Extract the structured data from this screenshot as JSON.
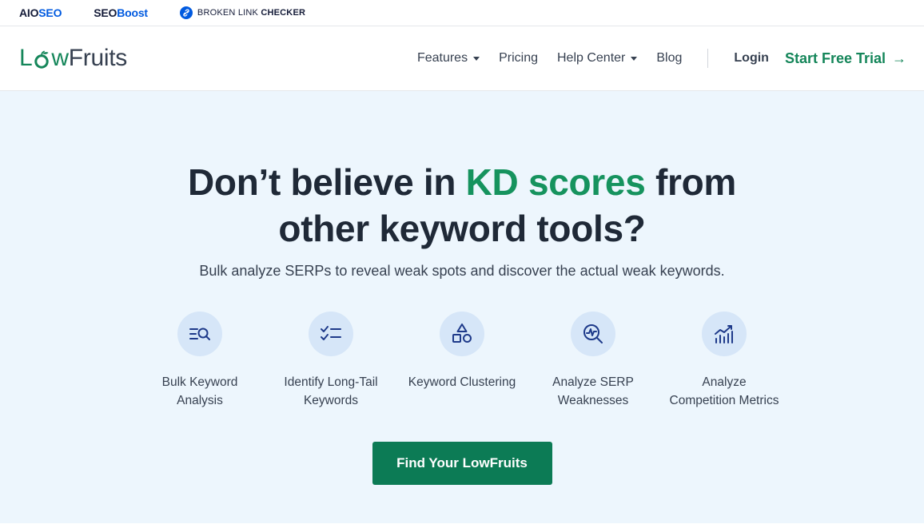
{
  "partners": {
    "aioseo": {
      "part1": "AIO",
      "part2": "SEO"
    },
    "seoboost": {
      "part1": "SEO",
      "part2": "Boost"
    },
    "blc": {
      "part1": "BROKEN LINK ",
      "part2": "CHECKER",
      "icon": "link-icon"
    }
  },
  "nav": {
    "logo": {
      "part1": "L",
      "part2": "w",
      "part3": "Fruits",
      "icon": "fruit-o-icon"
    },
    "menu": [
      {
        "label": "Features",
        "has_dropdown": true
      },
      {
        "label": "Pricing",
        "has_dropdown": false
      },
      {
        "label": "Help Center",
        "has_dropdown": true
      },
      {
        "label": "Blog",
        "has_dropdown": false
      }
    ],
    "login": "Login",
    "trial": "Start Free Trial",
    "trial_arrow": "→"
  },
  "hero": {
    "headline_pre": "Don’t believe in ",
    "headline_accent": "KD scores",
    "headline_post": " from",
    "headline_line2": "other keyword tools?",
    "subheading": "Bulk analyze SERPs to reveal weak spots and discover the actual weak keywords.",
    "features": [
      {
        "line1": "Bulk Keyword",
        "line2": "Analysis",
        "icon": "list-search-icon"
      },
      {
        "line1": "Identify Long-Tail",
        "line2": "Keywords",
        "icon": "checklist-icon"
      },
      {
        "line1": "Keyword Clustering",
        "line2": "",
        "icon": "shapes-icon"
      },
      {
        "line1": "Analyze SERP",
        "line2": "Weaknesses",
        "icon": "magnify-chart-icon"
      },
      {
        "line1": "Analyze",
        "line2": "Competition Metrics",
        "icon": "trend-chart-icon"
      }
    ],
    "cta": "Find Your LowFruits"
  },
  "colors": {
    "brand_green": "#15865a",
    "cta_green": "#0c7b55",
    "hero_bg": "#edf6fd",
    "icon_circle": "#d6e6f8",
    "icon_stroke": "#1e3a8a",
    "partner_blue": "#005ae0"
  }
}
